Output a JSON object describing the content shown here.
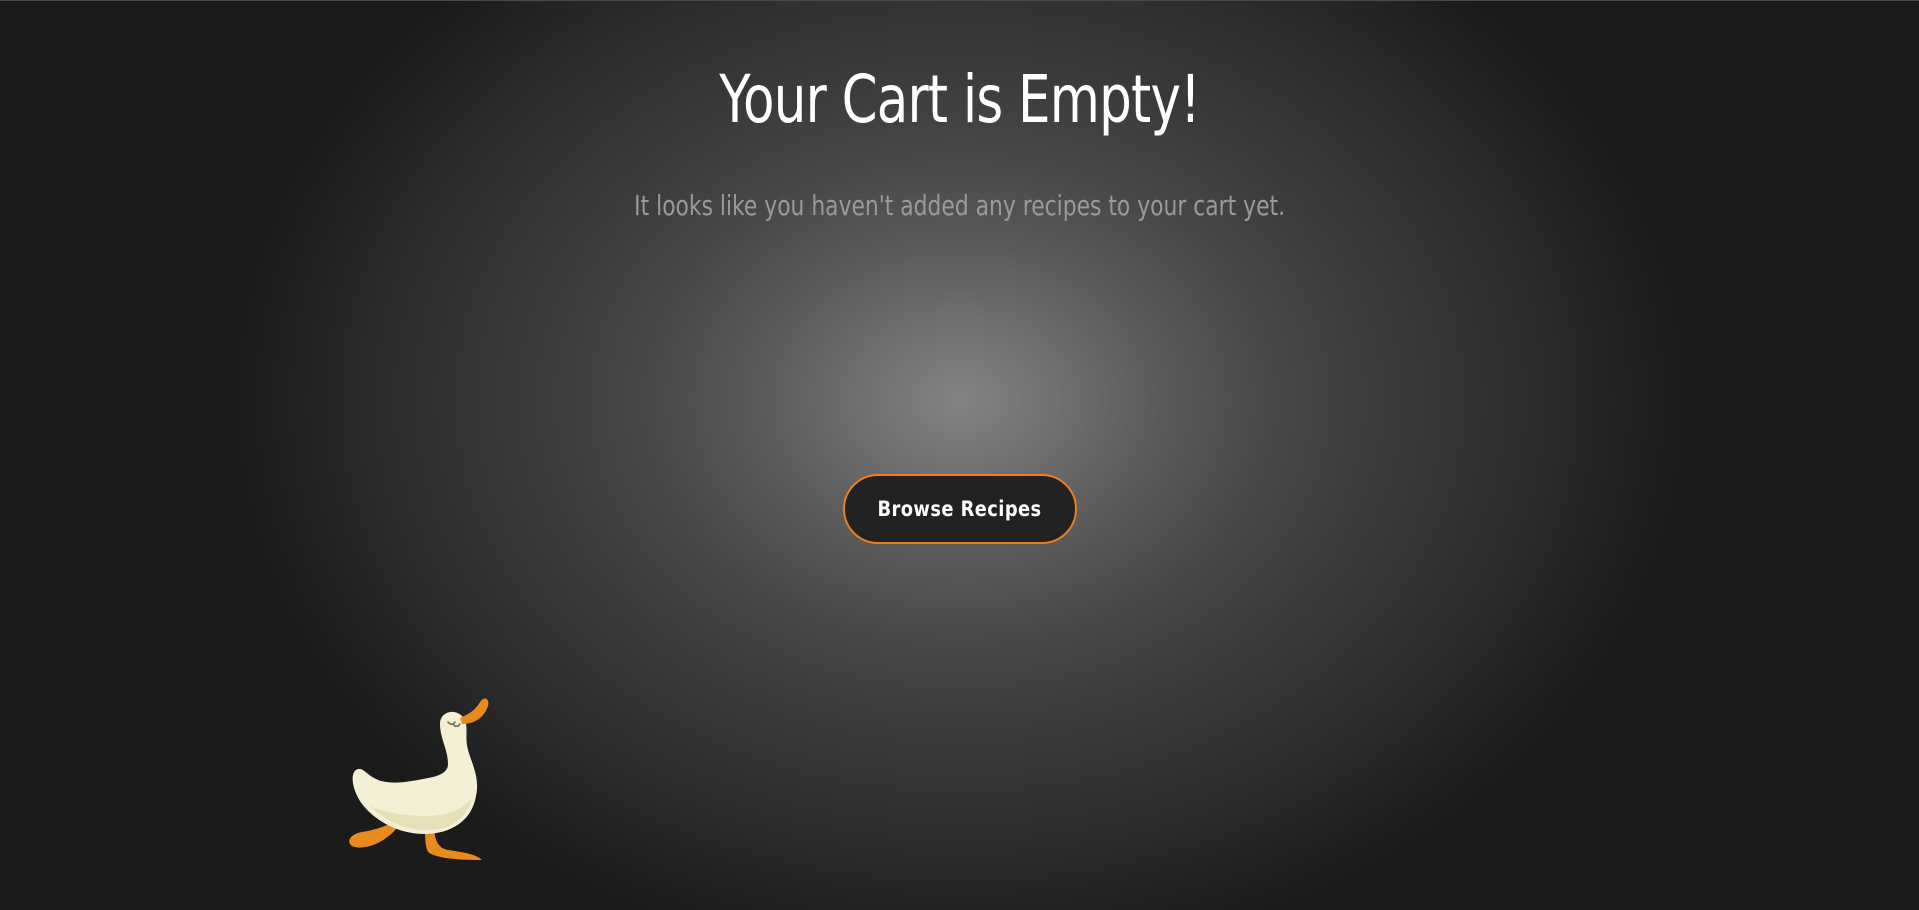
{
  "empty_cart": {
    "title": "Your Cart is Empty!",
    "subtitle": "It looks like you haven't added any recipes to your cart yet.",
    "browse_button_label": "Browse Recipes"
  },
  "illustration": {
    "name": "duck-illustration"
  },
  "colors": {
    "accent": "#e87f24",
    "button_bg": "#222222",
    "title_text": "#ffffff",
    "subtitle_text": "#9a9a9a",
    "duck_body": "#f4f0d6",
    "duck_shade": "#e6dfb8",
    "duck_feet": "#e88b1f"
  }
}
